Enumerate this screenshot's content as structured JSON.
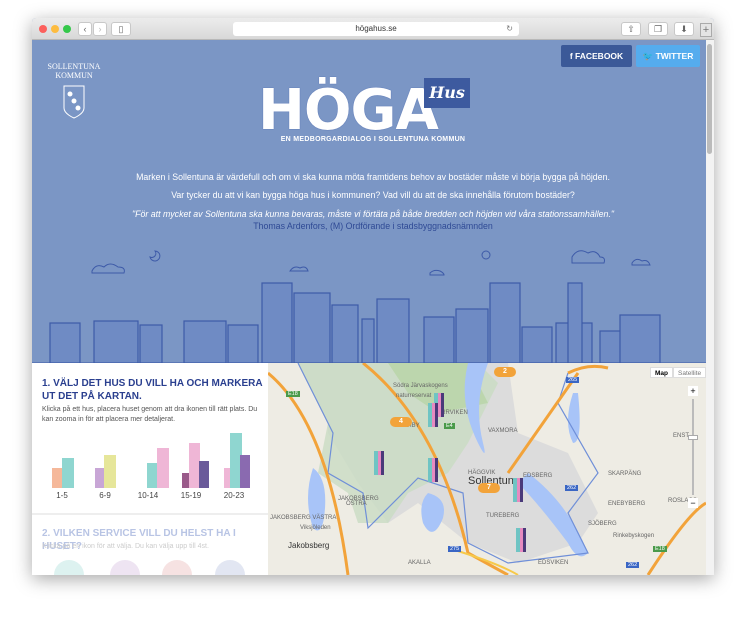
{
  "browser": {
    "url": "högahus.se"
  },
  "social": {
    "facebook": "FACEBOOK",
    "twitter": "TWITTER"
  },
  "municipality": {
    "line1": "SOLLENTUNA",
    "line2": "KOMMUN"
  },
  "hero": {
    "logo": "HÖGA",
    "logo_badge": "Hus",
    "tagline": "EN MEDBORGARDIALOG I SOLLENTUNA KOMMUN",
    "intro1": "Marken i Sollentuna är värdefull och om vi ska kunna möta framtidens behov av bostäder måste vi börja bygga på höjden.",
    "intro2": "Var tycker du att vi kan bygga höga hus i kommunen? Vad vill du att de ska innehålla förutom bostäder?",
    "quote": "\"För att mycket av Sollentuna ska kunna bevaras, måste vi förtäta på både bredden och höjden vid våra stationssamhällen.\"",
    "quote_author": "Thomas Ardenfors, (M) Ordförande i stadsbyggnadsnämnden"
  },
  "step1": {
    "title": "1. VÄLJ DET HUS DU VILL HA OCH MARKERA UT DET PÅ KARTAN.",
    "text": "Klicka på ett hus, placera huset genom att dra ikonen till rätt plats. Du kan zooma in för att placera mer detaljerat.",
    "houses": [
      {
        "label": "1-5"
      },
      {
        "label": "6-9"
      },
      {
        "label": "10-14"
      },
      {
        "label": "15-19"
      },
      {
        "label": "20-23"
      }
    ]
  },
  "step2": {
    "title": "2. VILKEN SERVICE VILL DU HELST HA I HUSET?",
    "text": "Klicka på en ikon för att välja. Du kan välja upp till 4st."
  },
  "map": {
    "type_map": "Map",
    "type_satellite": "Satellite",
    "zoom_in": "+",
    "zoom_out": "−",
    "places": [
      "Södra Järvaskogens",
      "naturreservat",
      "VIBY",
      "TORRVIKEN",
      "VAXMORA",
      "HÄGGVIK",
      "Sollentuna",
      "EDSBERG",
      "TUREBERG",
      "SJÖBERG",
      "SKARPÄNG",
      "ENEBYBERG",
      "ROSLAGS",
      "Rinkebyskogen",
      "JAKOBSBERG",
      "ÖSTRA",
      "JAKOBSBERG VÄSTRA",
      "Jakobsberg",
      "Viksjöleden",
      "AKALLA",
      "EDSVIKEN",
      "ENST"
    ],
    "roads": [
      "E18",
      "E4",
      "265",
      "262",
      "275",
      "E18",
      "262"
    ],
    "clusters": [
      "2",
      "4",
      "7"
    ]
  }
}
